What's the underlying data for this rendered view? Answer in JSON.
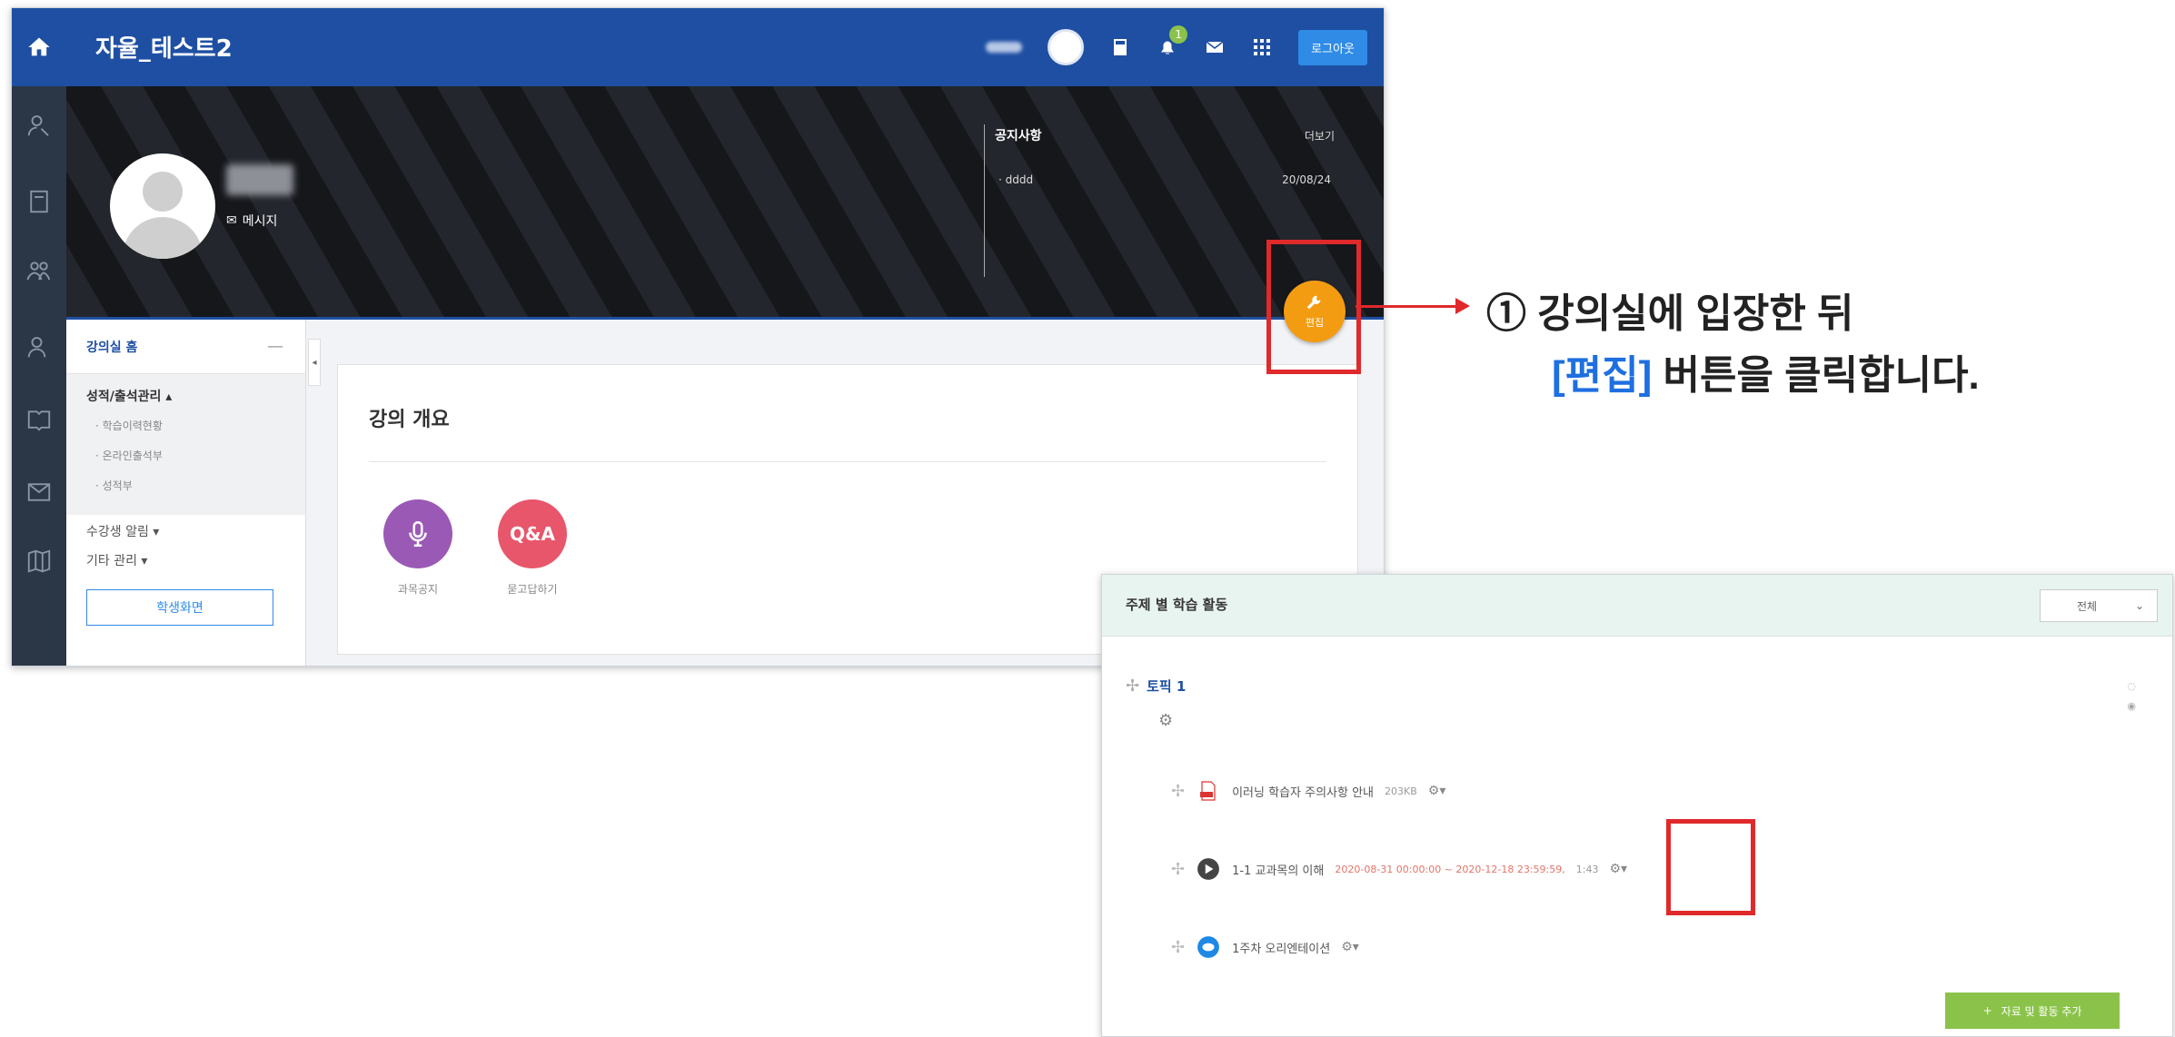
{
  "course": {
    "title": "자율_테스트2",
    "logout_label": "로그아웃",
    "notification_count": "1"
  },
  "profile": {
    "message_label": "메시지"
  },
  "notice": {
    "title": "공지사항",
    "more": "더보기",
    "item": "· dddd",
    "date": "20/08/24"
  },
  "edit_button_label": "편집",
  "left_menu": {
    "head": "강의실 홈",
    "collapse": "—",
    "group_title": "성적/출석관리 ▴",
    "sub_items": [
      "· 학습이력현황",
      "· 온라인출석부",
      "· 성적부"
    ],
    "items": [
      "수강생 알림 ▾",
      "기타 관리 ▾"
    ],
    "student_view": "학생화면"
  },
  "overview": {
    "title": "강의 개요",
    "icons": [
      {
        "name": "과목공지",
        "symbol": "mic",
        "color": "#9b59b6"
      },
      {
        "name": "묻고답하기",
        "symbol": "Q&A",
        "color": "#e8566b"
      }
    ]
  },
  "activities_panel": {
    "title": "주제 별 학습 활동",
    "filter": "전체",
    "topic": "토픽 1",
    "activities": [
      {
        "title": "이러닝 학습자 주의사항 안내",
        "meta": "203KB"
      },
      {
        "title": "1-1 교과목의 이해",
        "dates": "2020-08-31 00:00:00 ~ 2020-12-18 23:59:59,",
        "duration": "1:43"
      },
      {
        "title": "1주차 오리엔테이션"
      }
    ],
    "add_button": "자료 및 활동 추가"
  },
  "callout": {
    "line1": "① 강의실에 입장한 뒤",
    "line2_highlight": "[편집]",
    "line2_rest": " 버튼을 클릭합니다."
  },
  "colors": {
    "brand_blue": "#1e4fa3",
    "highlight_red": "#e0292b",
    "edit_orange": "#f39c12",
    "add_green": "#8bc34a"
  }
}
